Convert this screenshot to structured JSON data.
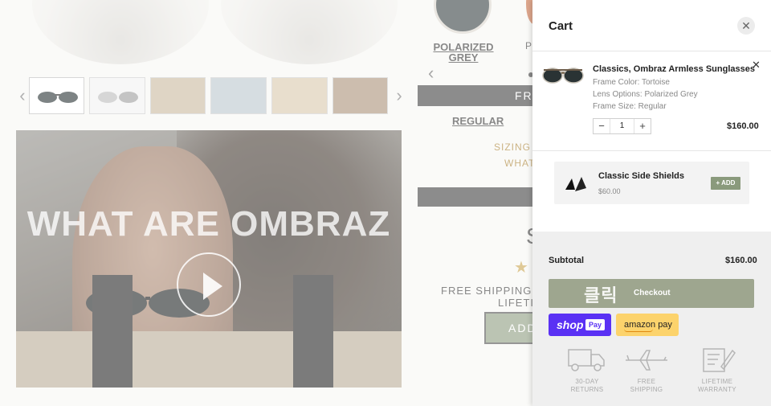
{
  "product_page": {
    "video_title": "WHAT ARE OMBRAZ",
    "lens_option_selected": "POLARIZED GREY",
    "lens_option_next_partial": "P",
    "frame_bar_partial": "FR",
    "size_selected": "REGULAR",
    "sizing_partial": "SIZING",
    "what_partial": "WHAT",
    "price_partial": "S",
    "shipping_partial": "FREE SHIPPING &",
    "lifetime_partial": "LIFETIM",
    "add_button_partial": "ADD"
  },
  "cart": {
    "title": "Cart",
    "close_glyph": "✕",
    "item": {
      "name": "Classics, Ombraz Armless Sunglasses",
      "remove_glyph": "✕",
      "options": [
        "Frame Color: Tortoise",
        "Lens Options: Polarized Grey",
        "Frame Size: Regular"
      ],
      "quantity": "1",
      "minus": "−",
      "plus": "+",
      "price": "$160.00"
    },
    "upsell": {
      "name": "Classic Side Shields",
      "price": "$60.00",
      "button_label": "+ ADD"
    },
    "subtotal_label": "Subtotal",
    "subtotal_value": "$160.00",
    "checkout_overlay_text": "클릭",
    "checkout_label": "Checkout",
    "shop_pay": {
      "brand": "shop",
      "pay": "Pay"
    },
    "amazon_pay": "amazon pay",
    "badges": [
      {
        "icon": "truck-icon",
        "line1": "30-DAY",
        "line2": "RETURNS"
      },
      {
        "icon": "airplane-icon",
        "line1": "FREE",
        "line2": "SHIPPING"
      },
      {
        "icon": "warranty-icon",
        "line1": "LIFETIME",
        "line2": "WARRANTY"
      }
    ]
  },
  "colors": {
    "accent_green": "#8a9a7c",
    "checkout_green": "#9ea68f",
    "shop_pay_purple": "#5a31f4",
    "amazon_yellow": "#fcd36c",
    "gold_text": "#a67c2a"
  }
}
